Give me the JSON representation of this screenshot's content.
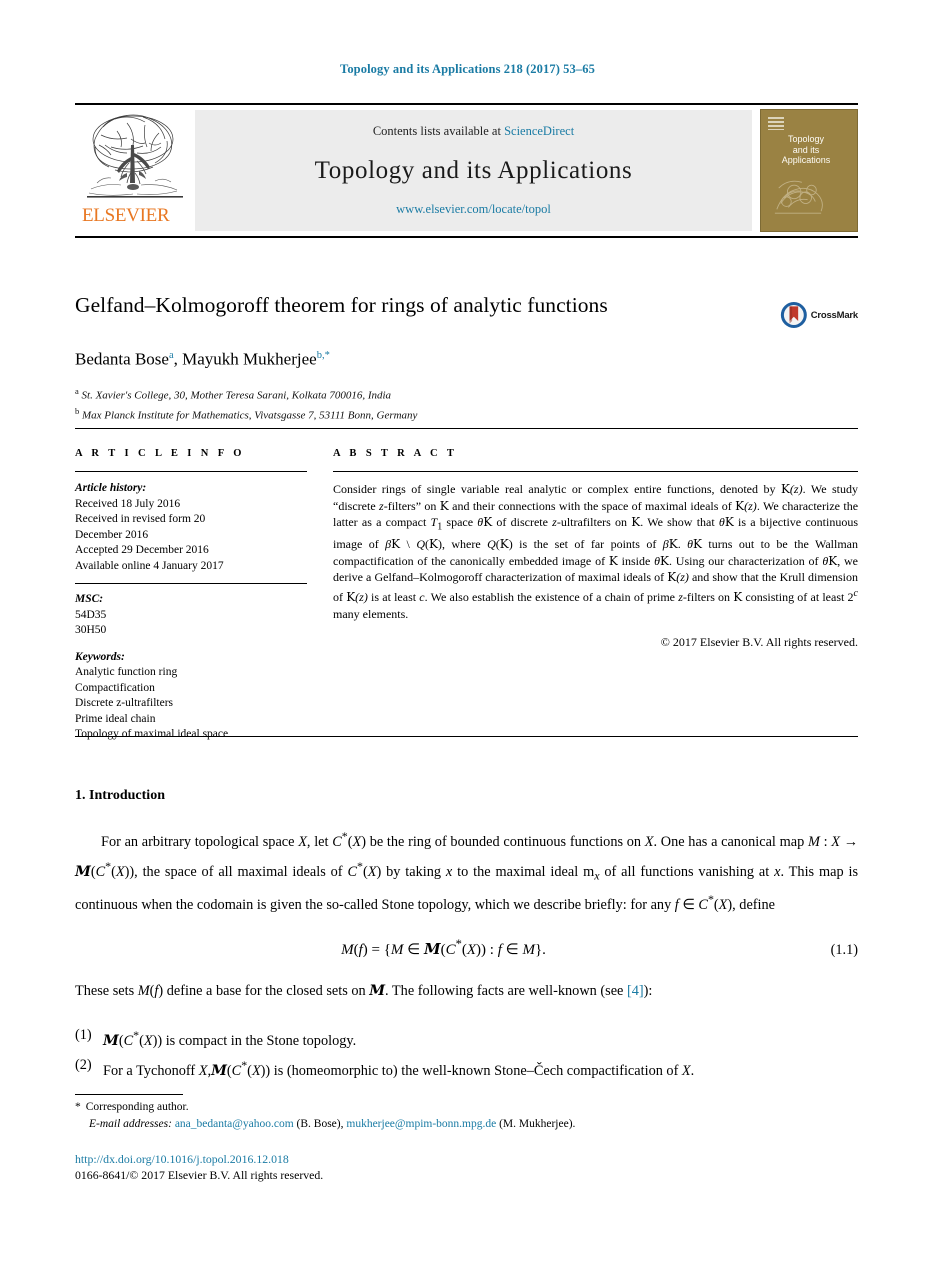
{
  "running_head": "Topology and its Applications 218 (2017) 53–65",
  "banner": {
    "publisher_name": "ELSEVIER",
    "contents_prefix": "Contents lists available at ",
    "contents_link": "ScienceDirect",
    "journal_title": "Topology and its Applications",
    "journal_url": "www.elsevier.com/locate/topol",
    "cover_title_line1": "Topology",
    "cover_title_line2": "and its",
    "cover_title_line3": "Applications",
    "cover_color": "#9a8243"
  },
  "article": {
    "title": "Gelfand–Kolmogoroff theorem for rings of analytic functions",
    "crossmark_label": "CrossMark",
    "authors_html": "Bedanta Bose<sup>a</sup>, Mayukh Mukherjee<sup>b,*</sup>",
    "affiliations": [
      {
        "marker": "a",
        "text": "St. Xavier's College, 30, Mother Teresa Sarani, Kolkata 700016, India"
      },
      {
        "marker": "b",
        "text": "Max Planck Institute for Mathematics, Vivatsgasse 7, 53111 Bonn, Germany"
      }
    ]
  },
  "info": {
    "caption": "A R T I C L E    I N F O",
    "history_label": "Article history:",
    "history_lines": [
      "Received 18 July 2016",
      "Received in revised form 20",
      "December 2016",
      "Accepted 29 December 2016",
      "Available online 4 January 2017"
    ],
    "msc_label": "MSC:",
    "msc_lines": [
      "54D35",
      "30H50"
    ],
    "keywords_label": "Keywords:",
    "keywords": [
      "Analytic function ring",
      "Compactification",
      "Discrete z-ultrafilters",
      "Prime ideal chain",
      "Topology of maximal ideal space"
    ]
  },
  "abstract": {
    "caption": "A B S T R A C T",
    "text_html": "Consider rings of single variable real analytic or complex entire functions, denoted by <span class=\"bb\">K</span><span class=\"mathit\">(z)</span>. We study “discrete <span class=\"mathit\">z</span>-filters” on <span class=\"bb\">K</span> and their connections with the space of maximal ideals of <span class=\"bb\">K</span><span class=\"mathit\">(z)</span>. We characterize the latter as a compact <span class=\"mathit\">T</span><sub>1</sub> space <span class=\"mathit\">θ</span><span class=\"bb\">K</span> of discrete <span class=\"mathit\">z</span>-ultrafilters on <span class=\"bb\">K</span>. We show that <span class=\"mathit\">θ</span><span class=\"bb\">K</span> is a bijective continuous image of <span class=\"mathit\">β</span><span class=\"bb\">K</span> \\ <span class=\"mathit\">Q</span>(<span class=\"bb\">K</span>), where <span class=\"mathit\">Q</span>(<span class=\"bb\">K</span>) is the set of far points of <span class=\"mathit\">β</span><span class=\"bb\">K</span>. <span class=\"mathit\">θ</span><span class=\"bb\">K</span> turns out to be the Wallman compactification of the canonically embedded image of <span class=\"bb\">K</span> inside <span class=\"mathit\">θ</span><span class=\"bb\">K</span>. Using our characterization of <span class=\"mathit\">θ</span><span class=\"bb\">K</span>, we derive a Gelfand–Kolmogoroff characterization of maximal ideals of <span class=\"bb\">K</span><span class=\"mathit\">(z)</span> and show that the Krull dimension of <span class=\"bb\">K</span><span class=\"mathit\">(z)</span> is at least <span class=\"mathit\">c</span>. We also establish the existence of a chain of prime <span class=\"mathit\">z</span>-filters on <span class=\"bb\">K</span> consisting of at least 2<sup><span class=\"mathit\">c</span></sup> many elements.",
    "copyright": "© 2017 Elsevier B.V. All rights reserved."
  },
  "body": {
    "section_heading": "1.  Introduction",
    "paragraph1_html": "For an arbitrary topological space <span class=\"it\">X</span>, let <span class=\"it\">C</span><sup>*</sup>(<span class=\"it\">X</span>) be the ring of bounded continuous functions on <span class=\"it\">X</span>. One has a canonical map <span class=\"it\">M</span> : <span class=\"it\">X</span> &rarr; <span class=\"frak\">M</span>(<span class=\"it\">C</span><sup>*</sup>(<span class=\"it\">X</span>)), the space of all maximal ideals of <span class=\"it\">C</span><sup>*</sup>(<span class=\"it\">X</span>) by taking <span class=\"it\">x</span> to the maximal ideal m<sub><span class=\"it\">x</span></sub> of all functions vanishing at <span class=\"it\">x</span>. This map is continuous when the codomain is given the so-called Stone topology, which we describe briefly: for any <span class=\"it\">f</span> &isin; <span class=\"it\">C</span><sup>*</sup>(<span class=\"it\">X</span>), define",
    "equation_html": "<span class=\"it\">M</span>(<span class=\"it\">f</span>) = {<span class=\"it\">M</span> &isin; <span class=\"frak\">M</span>(<span class=\"it\">C</span><sup>*</sup>(<span class=\"it\">X</span>)) : <span class=\"it\">f</span> &isin; <span class=\"it\">M</span>}.",
    "equation_number": "(1.1)",
    "paragraph2_html": "These sets <span class=\"it\">M</span>(<span class=\"it\">f</span>) define a base for the closed sets on <span class=\"frak\">M</span>. The following facts are well-known (see <span class=\"ref-link\">[4]</span>):",
    "list": [
      {
        "num": "(1)",
        "text_html": "<span class=\"frak\">M</span>(<span class=\"it\">C</span><sup>*</sup>(<span class=\"it\">X</span>)) is compact in the Stone topology."
      },
      {
        "num": "(2)",
        "text_html": "For a Tychonoff <span class=\"it\">X</span>,<span class=\"frak\">M</span>(<span class=\"it\">C</span><sup>*</sup>(<span class=\"it\">X</span>)) is (homeomorphic to) the well-known Stone&ndash;Čech compactification of <span class=\"it\">X</span>."
      }
    ]
  },
  "footer": {
    "corresponding_marker": "*",
    "corresponding_text": "Corresponding author.",
    "email_label": "E-mail addresses:",
    "email1": "ana_bedanta@yahoo.com",
    "email1_owner": "(B. Bose),",
    "email2": "mukherjee@mpim-bonn.mpg.de",
    "email2_owner": "(M. Mukherjee).",
    "doi": "http://dx.doi.org/10.1016/j.topol.2016.12.018",
    "issn": "0166-8641/© 2017 Elsevier B.V. All rights reserved."
  }
}
